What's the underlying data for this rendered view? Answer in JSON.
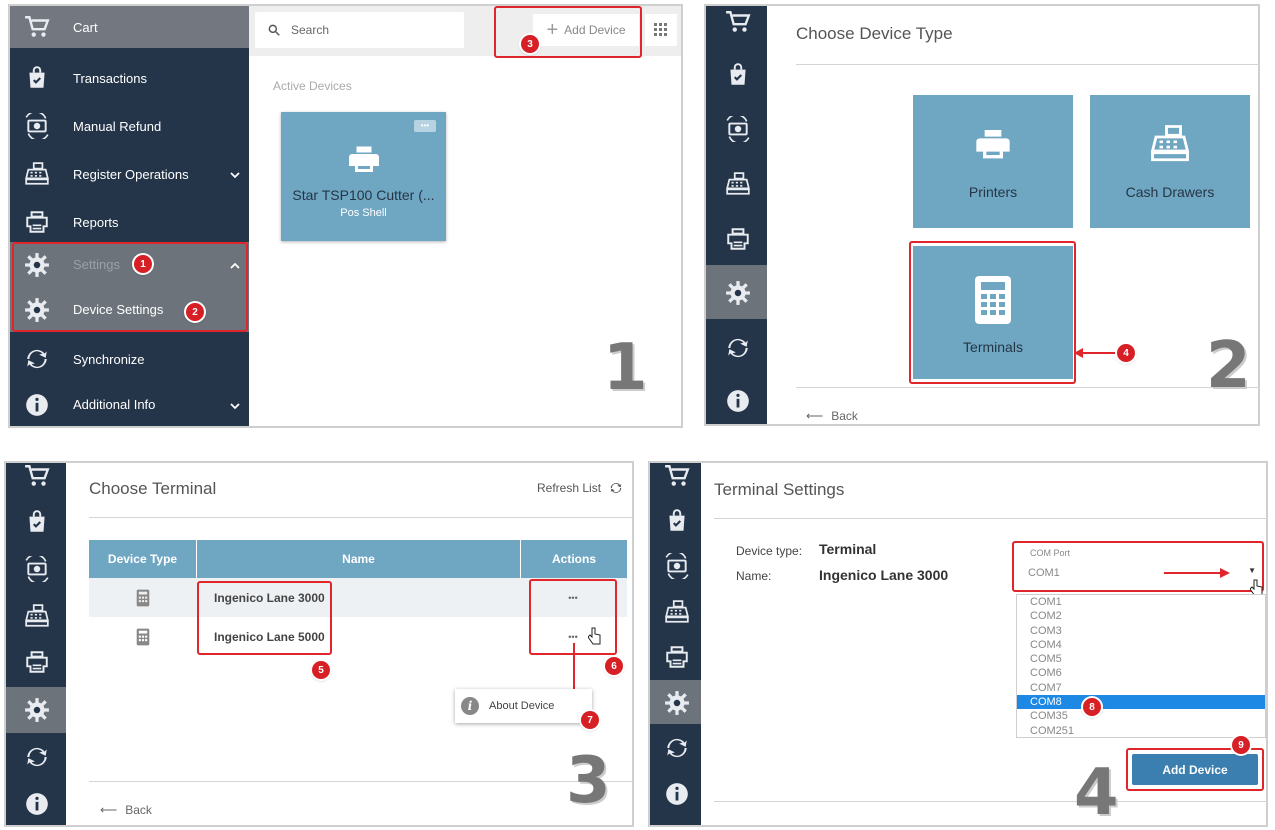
{
  "p1": {
    "menu": [
      {
        "label": "Cart",
        "icon": "cart-icon"
      },
      {
        "label": "Transactions",
        "icon": "bag-icon"
      },
      {
        "label": "Manual Refund",
        "icon": "refund-icon"
      },
      {
        "label": "Register Operations",
        "icon": "register-icon"
      },
      {
        "label": "Reports",
        "icon": "printer-icon"
      },
      {
        "label": "Settings",
        "icon": "gear-icon"
      },
      {
        "label": "Device Settings",
        "icon": "gear-icon"
      },
      {
        "label": "Synchronize",
        "icon": "sync-icon"
      },
      {
        "label": "Additional Info",
        "icon": "info-icon"
      }
    ],
    "search_placeholder": "Search",
    "add_device": "Add Device",
    "section_label": "Active Devices",
    "device": {
      "name": "Star TSP100 Cutter (...",
      "sub": "Pos Shell",
      "menu": "•••"
    },
    "badges": [
      "1",
      "2",
      "3"
    ],
    "step": "1"
  },
  "p2": {
    "title": "Choose Device Type",
    "tiles": [
      "Printers",
      "Cash Drawers",
      "Terminals"
    ],
    "badge": "4",
    "back": "Back",
    "step": "2"
  },
  "p3": {
    "title": "Choose Terminal",
    "refresh": "Refresh List",
    "headers": [
      "Device Type",
      "Name",
      "Actions"
    ],
    "rows": [
      {
        "name": "Ingenico Lane 3000",
        "actions": "•••"
      },
      {
        "name": "Ingenico Lane 5000",
        "actions": "•••"
      }
    ],
    "popup": "About Device",
    "badges": [
      "5",
      "6",
      "7"
    ],
    "back": "Back",
    "step": "3"
  },
  "p4": {
    "title": "Terminal Settings",
    "type_label": "Device type:",
    "type_value": "Terminal",
    "name_label": "Name:",
    "name_value": "Ingenico Lane 3000",
    "com_label": "COM Port",
    "com_value": "COM1",
    "options": [
      "COM1",
      "COM2",
      "COM3",
      "COM4",
      "COM5",
      "COM6",
      "COM7",
      "COM8",
      "COM35",
      "COM251"
    ],
    "selected": "COM8",
    "add_button": "Add Device",
    "badges": [
      "8",
      "9"
    ],
    "step": "4"
  },
  "colors": {
    "sidebar": "#243449",
    "tile": "#6fa7c3",
    "annotation": "#e0262a",
    "selected": "#1e88e5",
    "button": "#3a7fb0"
  }
}
